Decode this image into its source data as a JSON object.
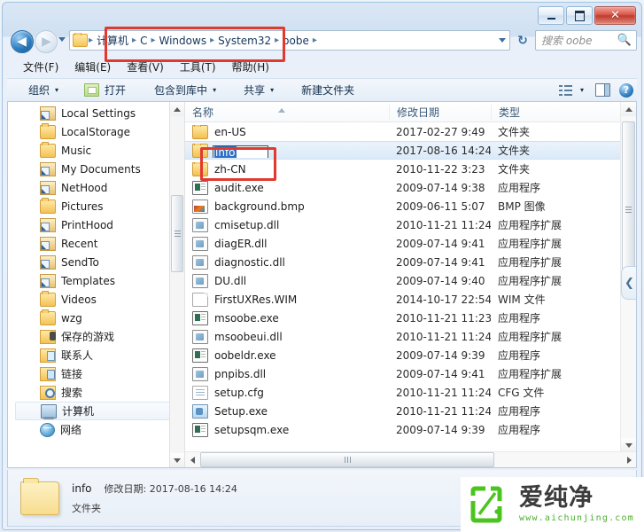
{
  "window": {
    "controls": {
      "minimize_label": "最小化",
      "maximize_label": "最大化",
      "close_label": "✕"
    }
  },
  "addressbar": {
    "back_label": "◀",
    "forward_label": "▶",
    "history_label": "历史记录",
    "crumbs": [
      "计算机",
      "C",
      "Windows",
      "System32",
      "oobe"
    ],
    "separator": "▸",
    "refresh_label": "↻",
    "dropdown_label": "▾"
  },
  "search": {
    "placeholder": "搜索 oobe",
    "value": "",
    "icon": "search-icon"
  },
  "menubar": {
    "items": [
      "文件(F)",
      "编辑(E)",
      "查看(V)",
      "工具(T)",
      "帮助(H)"
    ]
  },
  "toolbar": {
    "organize_label": "组织",
    "open_label": "打开",
    "include_library_label": "包含到库中",
    "share_label": "共享",
    "new_folder_label": "新建文件夹",
    "caret": "▾"
  },
  "navpane": {
    "items": [
      {
        "label": "Local Settings",
        "icon": "shortcut-folder-icon",
        "selected": false
      },
      {
        "label": "LocalStorage",
        "icon": "folder-icon",
        "selected": false
      },
      {
        "label": "Music",
        "icon": "folder-icon",
        "selected": false
      },
      {
        "label": "My Documents",
        "icon": "shortcut-folder-icon",
        "selected": false
      },
      {
        "label": "NetHood",
        "icon": "shortcut-folder-icon",
        "selected": false
      },
      {
        "label": "Pictures",
        "icon": "folder-icon",
        "selected": false
      },
      {
        "label": "PrintHood",
        "icon": "shortcut-folder-icon",
        "selected": false
      },
      {
        "label": "Recent",
        "icon": "shortcut-folder-icon",
        "selected": false
      },
      {
        "label": "SendTo",
        "icon": "shortcut-folder-icon",
        "selected": false
      },
      {
        "label": "Templates",
        "icon": "shortcut-folder-icon",
        "selected": false
      },
      {
        "label": "Videos",
        "icon": "folder-icon",
        "selected": false
      },
      {
        "label": "wzg",
        "icon": "folder-icon",
        "selected": false
      },
      {
        "label": "保存的游戏",
        "icon": "saved-games-icon",
        "selected": false
      },
      {
        "label": "联系人",
        "icon": "contacts-icon",
        "selected": false
      },
      {
        "label": "链接",
        "icon": "links-icon",
        "selected": false
      },
      {
        "label": "搜索",
        "icon": "searches-icon",
        "selected": false
      },
      {
        "label": "计算机",
        "icon": "computer-icon",
        "selected": true
      },
      {
        "label": "网络",
        "icon": "network-icon",
        "selected": false
      }
    ]
  },
  "filelist": {
    "columns": [
      "名称",
      "修改日期",
      "类型"
    ],
    "rows": [
      {
        "name": "en-US",
        "date": "2017-02-27 9:49",
        "type": "文件夹",
        "icon": "folder-icon",
        "selected": false,
        "renaming": false
      },
      {
        "name": "info",
        "date": "2017-08-16 14:24",
        "type": "文件夹",
        "icon": "folder-icon",
        "selected": true,
        "renaming": true
      },
      {
        "name": "zh-CN",
        "date": "2010-11-22 3:23",
        "type": "文件夹",
        "icon": "folder-icon",
        "selected": false,
        "renaming": false
      },
      {
        "name": "audit.exe",
        "date": "2009-07-14 9:38",
        "type": "应用程序",
        "icon": "exe-icon",
        "selected": false,
        "renaming": false
      },
      {
        "name": "background.bmp",
        "date": "2009-06-11 5:07",
        "type": "BMP 图像",
        "icon": "bmp-icon",
        "selected": false,
        "renaming": false
      },
      {
        "name": "cmisetup.dll",
        "date": "2010-11-21 11:24",
        "type": "应用程序扩展",
        "icon": "dll-icon",
        "selected": false,
        "renaming": false
      },
      {
        "name": "diagER.dll",
        "date": "2009-07-14 9:41",
        "type": "应用程序扩展",
        "icon": "dll-icon",
        "selected": false,
        "renaming": false
      },
      {
        "name": "diagnostic.dll",
        "date": "2009-07-14 9:41",
        "type": "应用程序扩展",
        "icon": "dll-icon",
        "selected": false,
        "renaming": false
      },
      {
        "name": "DU.dll",
        "date": "2009-07-14 9:40",
        "type": "应用程序扩展",
        "icon": "dll-icon",
        "selected": false,
        "renaming": false
      },
      {
        "name": "FirstUXRes.WIM",
        "date": "2014-10-17 22:54",
        "type": "WIM 文件",
        "icon": "plain-file-icon",
        "selected": false,
        "renaming": false
      },
      {
        "name": "msoobe.exe",
        "date": "2010-11-21 11:23",
        "type": "应用程序",
        "icon": "exe-icon",
        "selected": false,
        "renaming": false
      },
      {
        "name": "msoobeui.dll",
        "date": "2010-11-21 11:24",
        "type": "应用程序扩展",
        "icon": "dll-icon",
        "selected": false,
        "renaming": false
      },
      {
        "name": "oobeldr.exe",
        "date": "2009-07-14 9:39",
        "type": "应用程序",
        "icon": "exe-icon",
        "selected": false,
        "renaming": false
      },
      {
        "name": "pnpibs.dll",
        "date": "2009-07-14 9:41",
        "type": "应用程序扩展",
        "icon": "dll-icon",
        "selected": false,
        "renaming": false
      },
      {
        "name": "setup.cfg",
        "date": "2010-11-21 11:24",
        "type": "CFG 文件",
        "icon": "cfg-icon",
        "selected": false,
        "renaming": false
      },
      {
        "name": "Setup.exe",
        "date": "2010-11-21 11:24",
        "type": "应用程序",
        "icon": "setup-icon",
        "selected": false,
        "renaming": false
      },
      {
        "name": "setupsqm.exe",
        "date": "2009-07-14 9:39",
        "type": "应用程序",
        "icon": "exe-icon",
        "selected": false,
        "renaming": false
      }
    ],
    "rename_value": "info"
  },
  "details": {
    "name": "info",
    "modified_label": "修改日期:",
    "modified_value": "2017-08-16 14:24",
    "kind": "文件夹"
  },
  "watermark": {
    "brand_cn": "爱纯净",
    "url": "www.aichunjing.com",
    "logo_color": "#4cc41f"
  },
  "colors": {
    "accent": "#2f6fc4",
    "highlight_box": "#e03a2f",
    "selection": "#dbeaf8"
  }
}
